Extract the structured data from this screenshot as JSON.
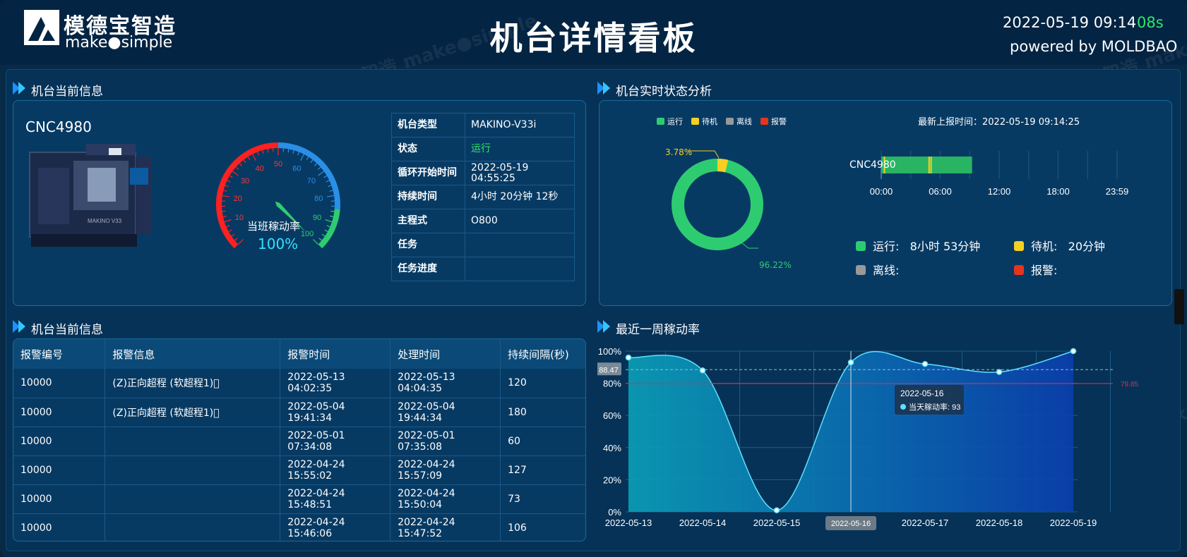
{
  "header": {
    "logo_cn": "模德宝智造",
    "logo_en": "make●simple",
    "title": "机台详情看板",
    "datetime": "2022-05-19 09:14",
    "seconds": "08s",
    "powered": "powered by MOLDBAO"
  },
  "watermark": {
    "cn": "模德宝智造",
    "en": "make●simple"
  },
  "left_top": {
    "section_title": "机台当前信息",
    "machine_name": "CNC4980",
    "gauge": {
      "label": "当班稼动率",
      "value_text": "100%",
      "value": 100,
      "ticks": [
        "10",
        "20",
        "30",
        "40",
        "50",
        "60",
        "70",
        "80",
        "90",
        "100"
      ]
    },
    "info": [
      {
        "key": "机台类型",
        "value": "MAKINO-V33i"
      },
      {
        "key": "状态",
        "value": "运行"
      },
      {
        "key": "循环开始时间",
        "value": "2022-05-19 04:55:25"
      },
      {
        "key": "持续时间",
        "value": "4小时 20分钟 12秒"
      },
      {
        "key": "主程式",
        "value": "O800"
      },
      {
        "key": "任务",
        "value": ""
      },
      {
        "key": "任务进度",
        "value": ""
      }
    ]
  },
  "right_top": {
    "section_title": "机台实时状态分析",
    "legend": [
      {
        "name": "运行",
        "color": "#2ecc71"
      },
      {
        "name": "待机",
        "color": "#f5d020"
      },
      {
        "name": "离线",
        "color": "#999999"
      },
      {
        "name": "报警",
        "color": "#e8341c"
      }
    ],
    "last_report_label": "最新上报时间：",
    "last_report_time": "2022-05-19 09:14:25",
    "donut": {
      "run_pct": 96.22,
      "idle_pct": 3.78,
      "run_label": "96.22%",
      "idle_label": "3.78%"
    },
    "timeline": {
      "machine": "CNC4980",
      "ticks": [
        "00:00",
        "06:00",
        "12:00",
        "18:00",
        "23:59"
      ],
      "run_hours": [
        0.0,
        9.24
      ],
      "idle_marks_hours": [
        0.25,
        4.8,
        5.0
      ]
    },
    "stats": [
      {
        "name": "运行:",
        "value": "8小时 53分钟",
        "color": "#2ecc71"
      },
      {
        "name": "待机:",
        "value": "20分钟",
        "color": "#f5d020"
      },
      {
        "name": "离线:",
        "value": "",
        "color": "#999999"
      },
      {
        "name": "报警:",
        "value": "",
        "color": "#e8341c"
      }
    ]
  },
  "left_bottom": {
    "section_title": "机台当前信息",
    "columns": [
      "报警编号",
      "报警信息",
      "报警时间",
      "处理时间",
      "持续间隔(秒)"
    ],
    "rows": [
      [
        "10000",
        "(Z)正向超程 (软超程1)\u0000",
        "2022-05-13 04:02:35",
        "2022-05-13 04:04:35",
        "120"
      ],
      [
        "10000",
        "(Z)正向超程 (软超程1)\u0000",
        "2022-05-04 19:41:34",
        "2022-05-04 19:44:34",
        "180"
      ],
      [
        "10000",
        "",
        "2022-05-01 07:34:08",
        "2022-05-01 07:35:08",
        "60"
      ],
      [
        "10000",
        "",
        "2022-04-24 15:55:02",
        "2022-04-24 15:57:09",
        "127"
      ],
      [
        "10000",
        "",
        "2022-04-24 15:48:51",
        "2022-04-24 15:50:04",
        "73"
      ],
      [
        "10000",
        "",
        "2022-04-24 15:46:06",
        "2022-04-24 15:47:52",
        "106"
      ]
    ]
  },
  "chart_data": {
    "type": "area",
    "title": "最近一周稼动率",
    "categories": [
      "2022-05-13",
      "2022-05-14",
      "2022-05-15",
      "2022-05-16",
      "2022-05-17",
      "2022-05-18",
      "2022-05-19"
    ],
    "series": [
      {
        "name": "当天稼动率",
        "values": [
          96,
          88,
          1,
          93,
          92,
          87,
          100
        ]
      }
    ],
    "y_ticks": [
      "0%",
      "20%",
      "40%",
      "60%",
      "80%",
      "100%"
    ],
    "ylim": [
      0,
      100
    ],
    "avg_line": {
      "value": 88.47,
      "label": "88.47"
    },
    "target_line": {
      "value": 79.85,
      "label": "79.85"
    },
    "tooltip": {
      "date": "2022-05-16",
      "text": "当天稼动率: 93"
    },
    "axis_pointer_label": "2022-05-16",
    "grid": true
  }
}
